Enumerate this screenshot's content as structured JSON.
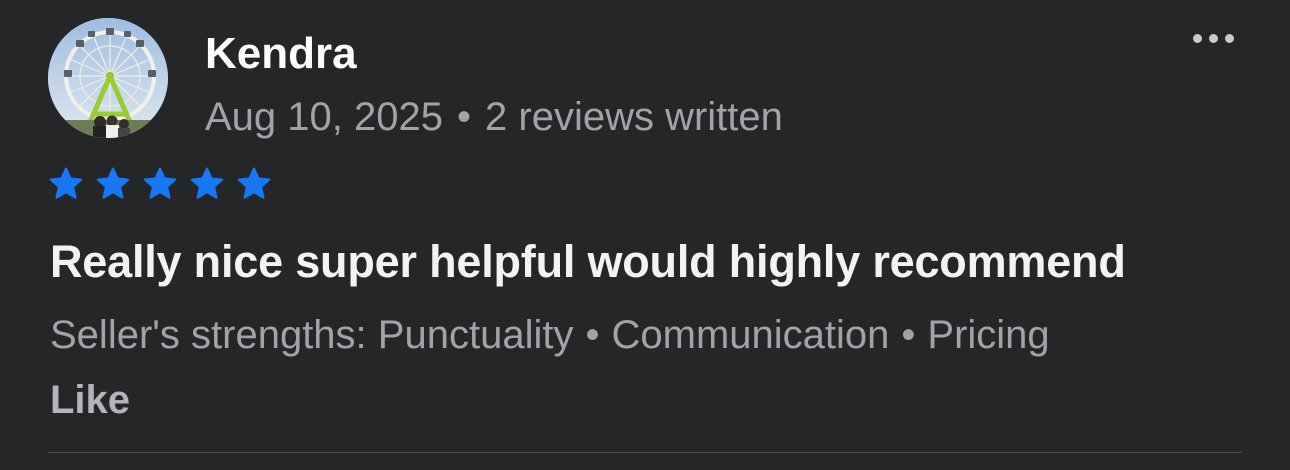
{
  "reviewer": {
    "name": "Kendra",
    "date": "Aug 10, 2025",
    "separator": "•",
    "review_count": "2 reviews written",
    "avatar_icon": "ferris-wheel-photo"
  },
  "menu": {
    "icon": "more-horizontal-icon"
  },
  "rating": {
    "value": 5,
    "max": 5,
    "star_color": "#1877f2"
  },
  "review": {
    "text": "Really nice super helpful would highly recommend"
  },
  "strengths": {
    "label": "Seller's strengths:",
    "items": [
      "Punctuality",
      "Communication",
      "Pricing"
    ],
    "separator": "•"
  },
  "actions": {
    "like_label": "Like"
  },
  "colors": {
    "background": "#252628",
    "primary_text": "#ffffff",
    "secondary_text": "#a1a3a8",
    "accent": "#1877f2"
  }
}
